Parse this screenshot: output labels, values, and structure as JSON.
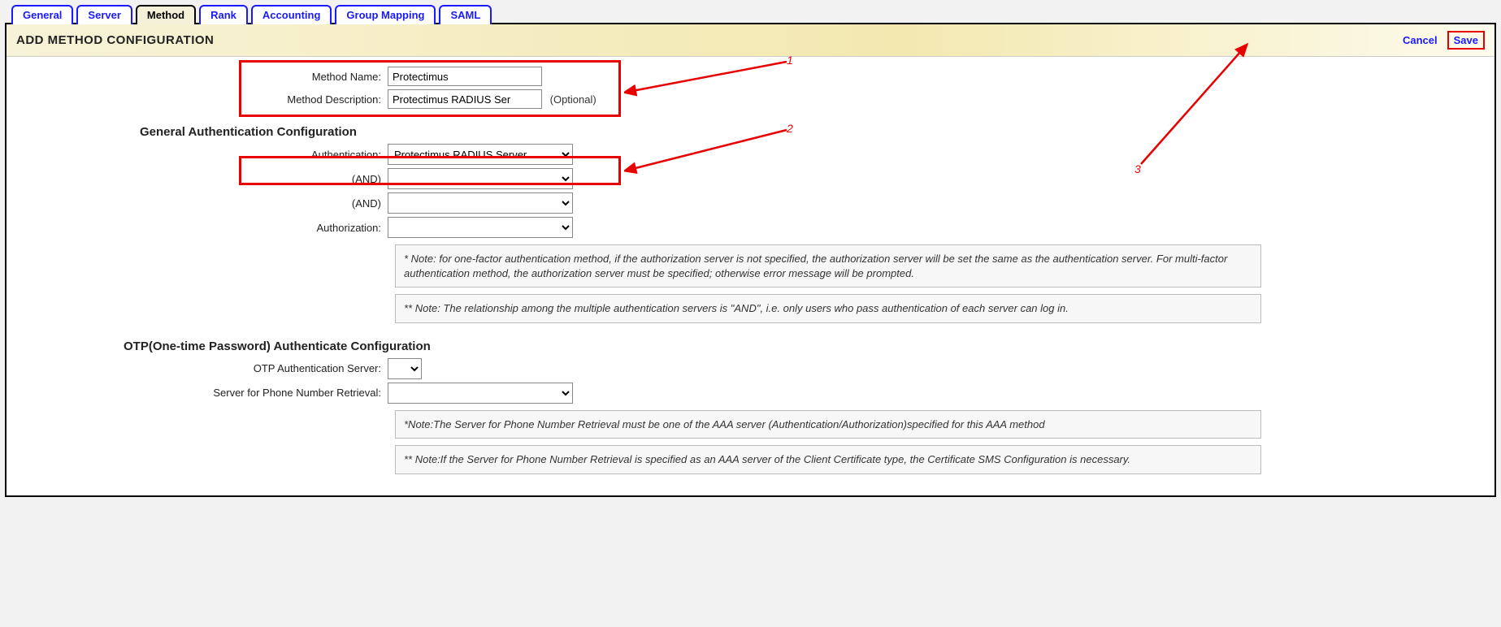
{
  "tabs": {
    "General": "General",
    "Server": "Server",
    "Method": "Method",
    "Rank": "Rank",
    "Accounting": "Accounting",
    "GroupMapping": "Group Mapping",
    "SAML": "SAML"
  },
  "header": {
    "title": "ADD METHOD CONFIGURATION",
    "cancel": "Cancel",
    "save": "Save"
  },
  "method": {
    "name_label": "Method Name:",
    "name_value": "Protectimus",
    "desc_label": "Method Description:",
    "desc_value": "Protectimus RADIUS Ser",
    "optional": "(Optional)"
  },
  "general_auth": {
    "section": "General Authentication Configuration",
    "auth_label": "Authentication:",
    "auth_value": "Protectimus RADIUS Server",
    "and1_label": "(AND)",
    "and2_label": "(AND)",
    "authz_label": "Authorization:",
    "note1": "* Note: for one-factor authentication method, if the authorization server is not specified, the authorization server will be set the same as the authentication server. For multi-factor authentication method, the authorization server must be specified; otherwise error message will be prompted.",
    "note2": "** Note: The relationship among the multiple authentication servers is \"AND\", i.e. only users who pass authentication of each server can log in."
  },
  "otp": {
    "section": "OTP(One-time Password) Authenticate Configuration",
    "server_label": "OTP Authentication Server:",
    "phone_label": "Server for Phone Number Retrieval:",
    "note1": "*Note:The Server for Phone Number Retrieval must be one of the AAA server (Authentication/Authorization)specified for this AAA method",
    "note2": "** Note:If the Server for Phone Number Retrieval is specified as an AAA server of the Client Certificate type, the Certificate SMS Configuration is necessary."
  },
  "annotations": {
    "a1": "1",
    "a2": "2",
    "a3": "3"
  }
}
